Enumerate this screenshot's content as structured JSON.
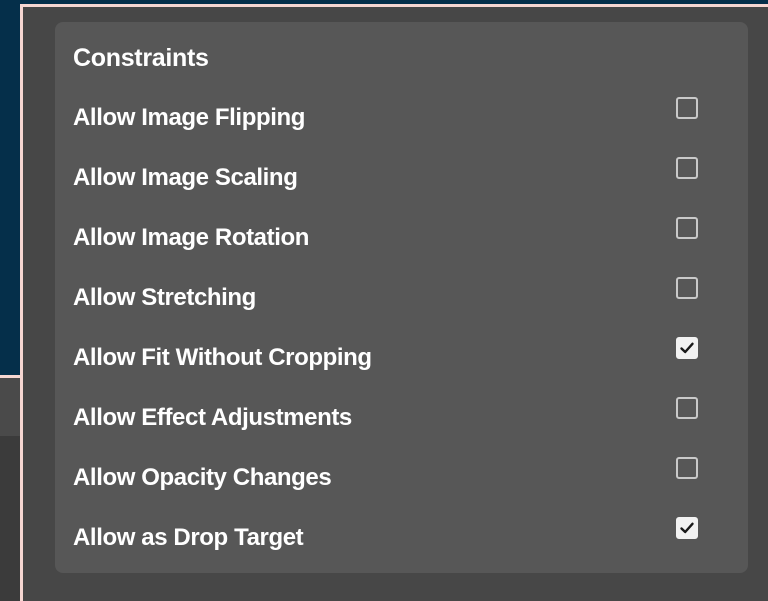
{
  "panel": {
    "title": "Constraints",
    "items": [
      {
        "label": "Allow Image Flipping",
        "checked": false
      },
      {
        "label": "Allow Image Scaling",
        "checked": false
      },
      {
        "label": "Allow Image Rotation",
        "checked": false
      },
      {
        "label": "Allow Stretching",
        "checked": false
      },
      {
        "label": "Allow Fit Without Cropping",
        "checked": true
      },
      {
        "label": "Allow Effect Adjustments",
        "checked": false
      },
      {
        "label": "Allow Opacity Changes",
        "checked": false
      },
      {
        "label": "Allow as Drop Target",
        "checked": true
      }
    ]
  },
  "colors": {
    "background_top": "#052f4a",
    "panel_frame": "#474747",
    "panel_body": "#575757",
    "accent_border": "#f6d7d2",
    "text": "#ffffff"
  },
  "icons": {
    "checkmark": "checkmark-icon"
  }
}
